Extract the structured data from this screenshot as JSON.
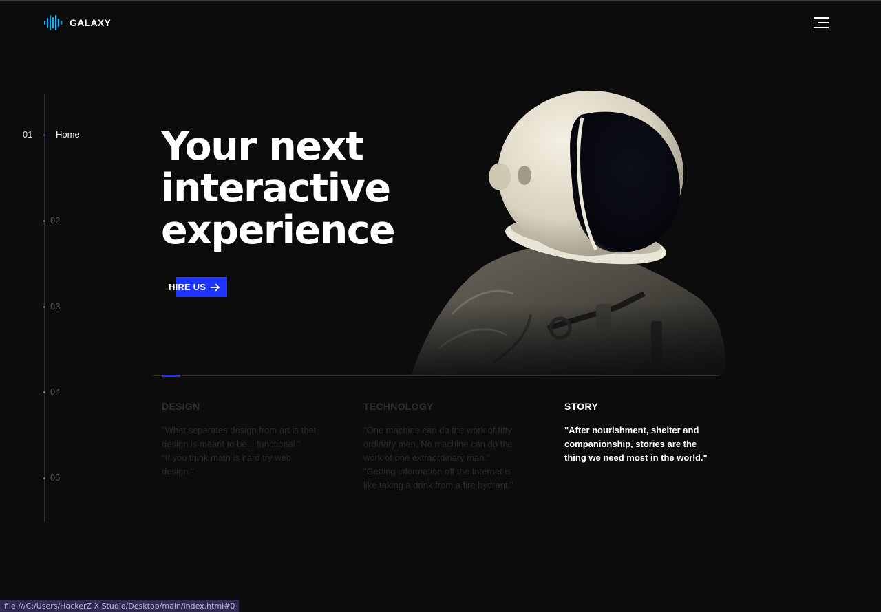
{
  "header": {
    "brand": "GALAXY",
    "logo_icon": "sound-wave-icon",
    "menu_icon": "hamburger-menu-icon",
    "brand_colors": [
      "#1ec8f0",
      "#1f3bff"
    ]
  },
  "side_nav": {
    "items": [
      {
        "num": "01",
        "label": "Home",
        "active": true
      },
      {
        "num": "02"
      },
      {
        "num": "03"
      },
      {
        "num": "04"
      },
      {
        "num": "05"
      }
    ]
  },
  "hero": {
    "line1": "Your next",
    "line2": "interactive",
    "line3": "experience",
    "cta_label": "HIRE US",
    "cta_icon": "arrow-right-icon",
    "accent_color": "#1d34ff"
  },
  "features": {
    "design": {
      "title": "DESIGN",
      "quote1": "\"What separates design from art is that design is meant to be... functional.\"",
      "quote2": "\"If you think math is hard try web design.\""
    },
    "technology": {
      "title": "TECHNOLOGY",
      "quote1": "\"One machine can do the work of fifty ordinary men. No machine can do the work of one extraordinary man.\"",
      "quote2": "\"Getting information off the Internet is like taking a drink from a fire hydrant.\""
    },
    "story": {
      "title": "STORY",
      "quote1": "\"After nourishment, shelter and companionship, stories are the thing we need most in the world.\""
    }
  },
  "status_bar": {
    "url": "file:///C:/Users/HackerZ X Studio/Desktop/main/index.html#0"
  }
}
